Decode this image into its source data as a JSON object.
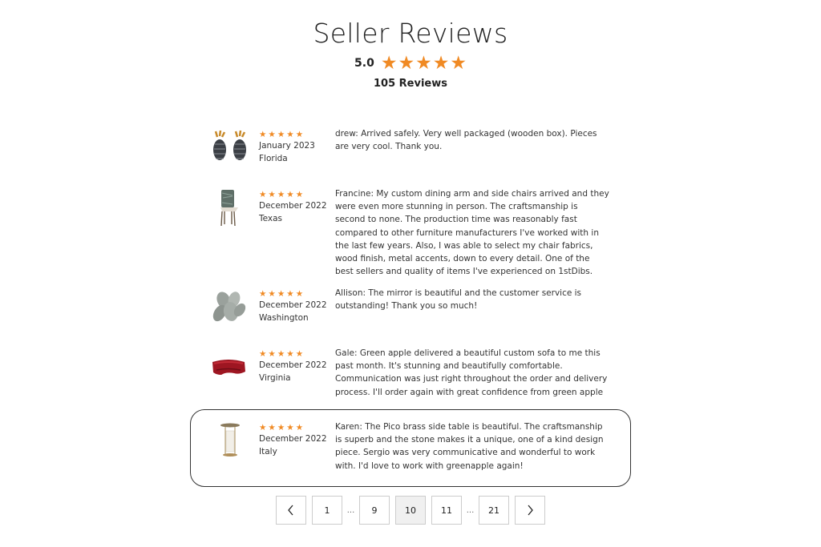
{
  "header": {
    "title": "Seller Reviews",
    "rating": "5.0",
    "review_count": "105 Reviews"
  },
  "colors": {
    "star": "#f08a24",
    "border": "#333333",
    "active_page_bg": "#f0f0f0"
  },
  "reviews": [
    {
      "rating": 5,
      "date": "January 2023",
      "location": "Florida",
      "thumbnail": "pineapple-vases-icon",
      "text": "drew: Arrived safely. Very well packaged (wooden box). Pieces are very cool. Thank you."
    },
    {
      "rating": 5,
      "date": "December 2022",
      "location": "Texas",
      "thumbnail": "dining-chair-icon",
      "text": "Francine: My custom dining arm and side chairs arrived and they were even more stunning in person. The craftsmanship is second to none. The production time was reasonably fast compared to other furniture manufacturers I've worked with in the last few years. Also, I was able to select my chair fabrics, wood finish, metal accents, down to every detail. One of the best sellers and quality of items I've experienced on 1stDibs."
    },
    {
      "rating": 5,
      "date": "December 2022",
      "location": "Washington",
      "thumbnail": "leaf-mirror-icon",
      "text": "Allison: The mirror is beautiful and the customer service is outstanding! Thank you so much!"
    },
    {
      "rating": 5,
      "date": "December 2022",
      "location": "Virginia",
      "thumbnail": "red-sofa-icon",
      "text": "Gale: Green apple delivered a beautiful custom sofa to me this past month. It's stunning and beautifully comfortable. Communication was just right throughout the order and delivery process. I'll order again with great confidence from green apple"
    },
    {
      "rating": 5,
      "date": "December 2022",
      "location": "Italy",
      "thumbnail": "side-table-icon",
      "text": "Karen: The Pico brass side table is beautiful. The craftsmanship is superb and the stone makes it a unique, one of a kind design piece. Sergio was very communicative and wonderful to work with. I'd love to work with greenapple again!"
    }
  ],
  "pagination": {
    "prev_icon": "chevron-left-icon",
    "next_icon": "chevron-right-icon",
    "pages": [
      "1",
      "9",
      "10",
      "11",
      "21"
    ],
    "ellipsis": "...",
    "current": "10"
  }
}
